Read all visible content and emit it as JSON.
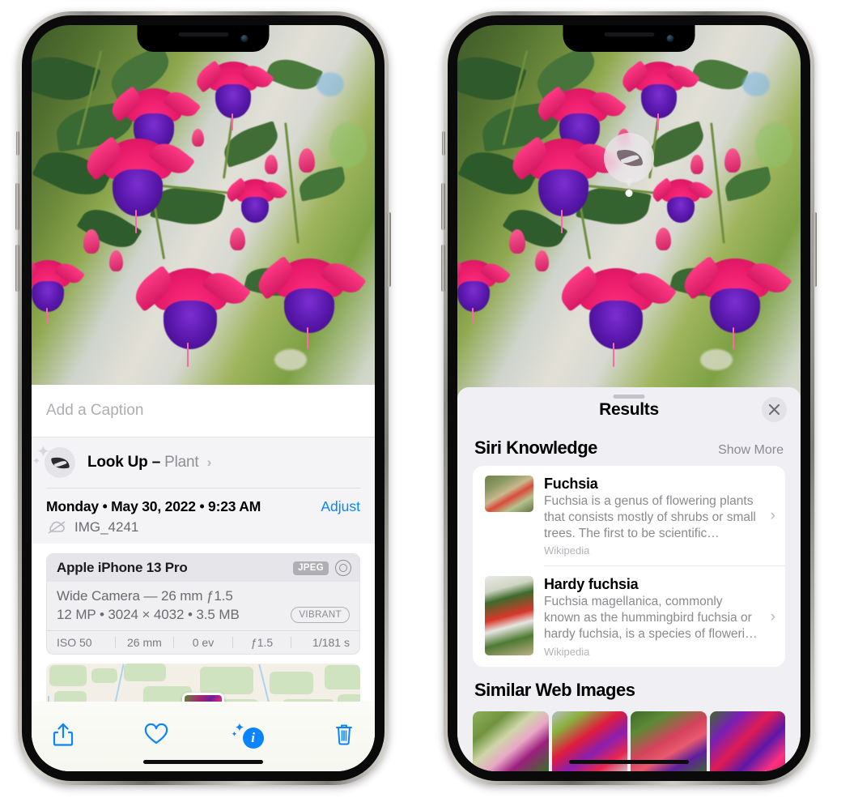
{
  "left_phone": {
    "caption": {
      "placeholder": "Add a Caption",
      "value": ""
    },
    "lookup": {
      "label": "Look Up",
      "dash": "–",
      "kind": "Plant",
      "chevron": "›",
      "icon": "leaf-icon"
    },
    "metadata": {
      "date": "Monday • May 30, 2022 • 9:23 AM",
      "adjust_label": "Adjust",
      "filename": "IMG_4241",
      "cloud_icon": "cloud-slash-icon"
    },
    "camera": {
      "model": "Apple iPhone 13 Pro",
      "format_badge": "JPEG",
      "aperture_icon": "aperture-icon",
      "lens_line": "Wide Camera — 26 mm ƒ1.5",
      "size_line": "12 MP • 3024 × 4032 • 3.5 MB",
      "style_badge": "VIBRANT",
      "exif": [
        "ISO 50",
        "26 mm",
        "0 ev",
        "ƒ1.5",
        "1/181 s"
      ]
    },
    "toolbar": {
      "share_label": "share-icon",
      "favorite_label": "heart-icon",
      "info_label": "i",
      "delete_label": "trash-icon"
    }
  },
  "right_phone": {
    "badge": {
      "icon": "leaf-icon"
    },
    "sheet": {
      "title": "Results",
      "close_label": "✕"
    },
    "siri_knowledge": {
      "title": "Siri Knowledge",
      "action": "Show More",
      "items": [
        {
          "title": "Fuchsia",
          "description": "Fuchsia is a genus of flowering plants that consists mostly of shrubs or small trees. The first to be scientific…",
          "source": "Wikipedia",
          "chevron": "›"
        },
        {
          "title": "Hardy fuchsia",
          "description": "Fuchsia magellanica, commonly known as the hummingbird fuchsia or hardy fuchsia, is a species of floweri…",
          "source": "Wikipedia",
          "chevron": "›"
        }
      ]
    },
    "similar_web_images": {
      "title": "Similar Web Images",
      "count": 4
    }
  },
  "colors": {
    "accent_blue": "#0A84FF",
    "sheet_bg": "#F0EFF4",
    "card_bg": "#FFFFFF",
    "secondary_text": "#8A8A90"
  }
}
